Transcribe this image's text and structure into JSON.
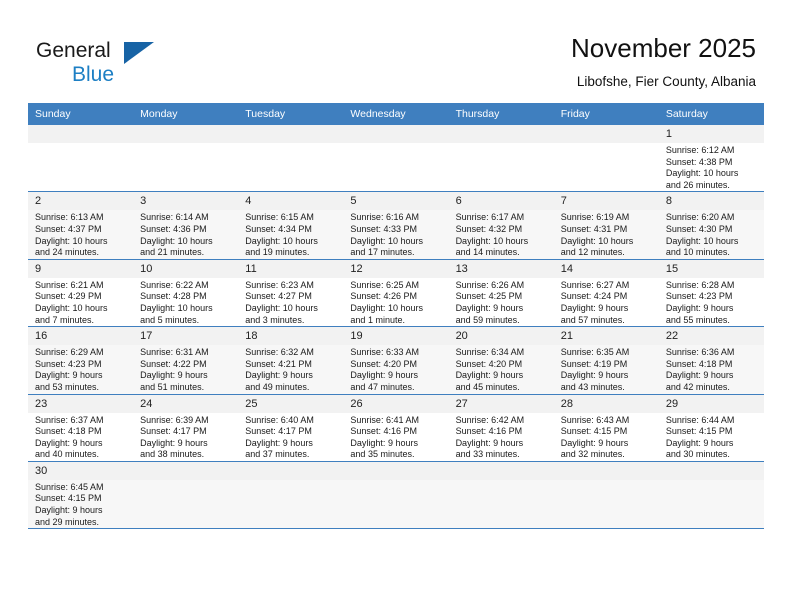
{
  "logo": {
    "word1": "General",
    "word2": "Blue",
    "mark": "triangle-logo-mark"
  },
  "header": {
    "title": "November 2025",
    "subtitle": "Libofshe, Fier County, Albania"
  },
  "colors": {
    "header_band": "#3f7fbf",
    "logo_blue": "#1d7fc4",
    "day_shade": "#f2f2f2"
  },
  "weekdays": [
    "Sunday",
    "Monday",
    "Tuesday",
    "Wednesday",
    "Thursday",
    "Friday",
    "Saturday"
  ],
  "weeks": [
    [
      {
        "empty": true
      },
      {
        "empty": true
      },
      {
        "empty": true
      },
      {
        "empty": true
      },
      {
        "empty": true
      },
      {
        "empty": true
      },
      {
        "day": "1",
        "sunrise": "Sunrise: 6:12 AM",
        "sunset": "Sunset: 4:38 PM",
        "daylight1": "Daylight: 10 hours",
        "daylight2": "and 26 minutes."
      }
    ],
    [
      {
        "day": "2",
        "sunrise": "Sunrise: 6:13 AM",
        "sunset": "Sunset: 4:37 PM",
        "daylight1": "Daylight: 10 hours",
        "daylight2": "and 24 minutes."
      },
      {
        "day": "3",
        "sunrise": "Sunrise: 6:14 AM",
        "sunset": "Sunset: 4:36 PM",
        "daylight1": "Daylight: 10 hours",
        "daylight2": "and 21 minutes."
      },
      {
        "day": "4",
        "sunrise": "Sunrise: 6:15 AM",
        "sunset": "Sunset: 4:34 PM",
        "daylight1": "Daylight: 10 hours",
        "daylight2": "and 19 minutes."
      },
      {
        "day": "5",
        "sunrise": "Sunrise: 6:16 AM",
        "sunset": "Sunset: 4:33 PM",
        "daylight1": "Daylight: 10 hours",
        "daylight2": "and 17 minutes."
      },
      {
        "day": "6",
        "sunrise": "Sunrise: 6:17 AM",
        "sunset": "Sunset: 4:32 PM",
        "daylight1": "Daylight: 10 hours",
        "daylight2": "and 14 minutes."
      },
      {
        "day": "7",
        "sunrise": "Sunrise: 6:19 AM",
        "sunset": "Sunset: 4:31 PM",
        "daylight1": "Daylight: 10 hours",
        "daylight2": "and 12 minutes."
      },
      {
        "day": "8",
        "sunrise": "Sunrise: 6:20 AM",
        "sunset": "Sunset: 4:30 PM",
        "daylight1": "Daylight: 10 hours",
        "daylight2": "and 10 minutes."
      }
    ],
    [
      {
        "day": "9",
        "sunrise": "Sunrise: 6:21 AM",
        "sunset": "Sunset: 4:29 PM",
        "daylight1": "Daylight: 10 hours",
        "daylight2": "and 7 minutes."
      },
      {
        "day": "10",
        "sunrise": "Sunrise: 6:22 AM",
        "sunset": "Sunset: 4:28 PM",
        "daylight1": "Daylight: 10 hours",
        "daylight2": "and 5 minutes."
      },
      {
        "day": "11",
        "sunrise": "Sunrise: 6:23 AM",
        "sunset": "Sunset: 4:27 PM",
        "daylight1": "Daylight: 10 hours",
        "daylight2": "and 3 minutes."
      },
      {
        "day": "12",
        "sunrise": "Sunrise: 6:25 AM",
        "sunset": "Sunset: 4:26 PM",
        "daylight1": "Daylight: 10 hours",
        "daylight2": "and 1 minute."
      },
      {
        "day": "13",
        "sunrise": "Sunrise: 6:26 AM",
        "sunset": "Sunset: 4:25 PM",
        "daylight1": "Daylight: 9 hours",
        "daylight2": "and 59 minutes."
      },
      {
        "day": "14",
        "sunrise": "Sunrise: 6:27 AM",
        "sunset": "Sunset: 4:24 PM",
        "daylight1": "Daylight: 9 hours",
        "daylight2": "and 57 minutes."
      },
      {
        "day": "15",
        "sunrise": "Sunrise: 6:28 AM",
        "sunset": "Sunset: 4:23 PM",
        "daylight1": "Daylight: 9 hours",
        "daylight2": "and 55 minutes."
      }
    ],
    [
      {
        "day": "16",
        "sunrise": "Sunrise: 6:29 AM",
        "sunset": "Sunset: 4:23 PM",
        "daylight1": "Daylight: 9 hours",
        "daylight2": "and 53 minutes."
      },
      {
        "day": "17",
        "sunrise": "Sunrise: 6:31 AM",
        "sunset": "Sunset: 4:22 PM",
        "daylight1": "Daylight: 9 hours",
        "daylight2": "and 51 minutes."
      },
      {
        "day": "18",
        "sunrise": "Sunrise: 6:32 AM",
        "sunset": "Sunset: 4:21 PM",
        "daylight1": "Daylight: 9 hours",
        "daylight2": "and 49 minutes."
      },
      {
        "day": "19",
        "sunrise": "Sunrise: 6:33 AM",
        "sunset": "Sunset: 4:20 PM",
        "daylight1": "Daylight: 9 hours",
        "daylight2": "and 47 minutes."
      },
      {
        "day": "20",
        "sunrise": "Sunrise: 6:34 AM",
        "sunset": "Sunset: 4:20 PM",
        "daylight1": "Daylight: 9 hours",
        "daylight2": "and 45 minutes."
      },
      {
        "day": "21",
        "sunrise": "Sunrise: 6:35 AM",
        "sunset": "Sunset: 4:19 PM",
        "daylight1": "Daylight: 9 hours",
        "daylight2": "and 43 minutes."
      },
      {
        "day": "22",
        "sunrise": "Sunrise: 6:36 AM",
        "sunset": "Sunset: 4:18 PM",
        "daylight1": "Daylight: 9 hours",
        "daylight2": "and 42 minutes."
      }
    ],
    [
      {
        "day": "23",
        "sunrise": "Sunrise: 6:37 AM",
        "sunset": "Sunset: 4:18 PM",
        "daylight1": "Daylight: 9 hours",
        "daylight2": "and 40 minutes."
      },
      {
        "day": "24",
        "sunrise": "Sunrise: 6:39 AM",
        "sunset": "Sunset: 4:17 PM",
        "daylight1": "Daylight: 9 hours",
        "daylight2": "and 38 minutes."
      },
      {
        "day": "25",
        "sunrise": "Sunrise: 6:40 AM",
        "sunset": "Sunset: 4:17 PM",
        "daylight1": "Daylight: 9 hours",
        "daylight2": "and 37 minutes."
      },
      {
        "day": "26",
        "sunrise": "Sunrise: 6:41 AM",
        "sunset": "Sunset: 4:16 PM",
        "daylight1": "Daylight: 9 hours",
        "daylight2": "and 35 minutes."
      },
      {
        "day": "27",
        "sunrise": "Sunrise: 6:42 AM",
        "sunset": "Sunset: 4:16 PM",
        "daylight1": "Daylight: 9 hours",
        "daylight2": "and 33 minutes."
      },
      {
        "day": "28",
        "sunrise": "Sunrise: 6:43 AM",
        "sunset": "Sunset: 4:15 PM",
        "daylight1": "Daylight: 9 hours",
        "daylight2": "and 32 minutes."
      },
      {
        "day": "29",
        "sunrise": "Sunrise: 6:44 AM",
        "sunset": "Sunset: 4:15 PM",
        "daylight1": "Daylight: 9 hours",
        "daylight2": "and 30 minutes."
      }
    ],
    [
      {
        "day": "30",
        "sunrise": "Sunrise: 6:45 AM",
        "sunset": "Sunset: 4:15 PM",
        "daylight1": "Daylight: 9 hours",
        "daylight2": "and 29 minutes."
      },
      {
        "empty": true
      },
      {
        "empty": true
      },
      {
        "empty": true
      },
      {
        "empty": true
      },
      {
        "empty": true
      },
      {
        "empty": true
      }
    ]
  ]
}
